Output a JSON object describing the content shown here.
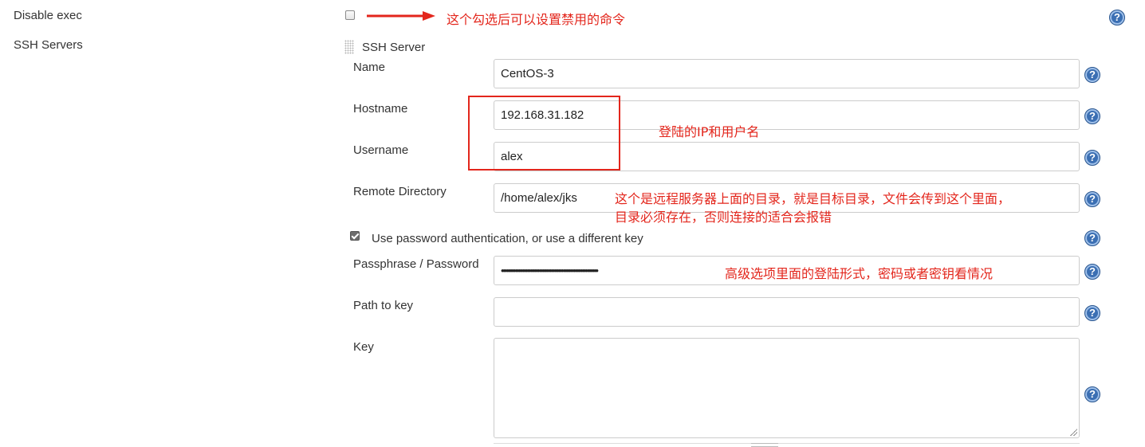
{
  "labels": {
    "disable_exec": "Disable exec",
    "ssh_servers": "SSH Servers",
    "ssh_server": "SSH Server",
    "name": "Name",
    "hostname": "Hostname",
    "username": "Username",
    "remote_directory": "Remote Directory",
    "use_password": "Use password authentication, or use a different key",
    "passphrase": "Passphrase / Password",
    "path_to_key": "Path to key",
    "key": "Key"
  },
  "values": {
    "name": "CentOS-3",
    "hostname": "192.168.31.182",
    "username": "alex",
    "remote_directory": "/home/alex/jks",
    "passphrase_masked": "••••••••••••••••••••••••••••••••••••••••••••••••••••••••",
    "path_to_key": "",
    "key": ""
  },
  "checkboxes": {
    "disable_exec_checked": false,
    "use_password_checked": true
  },
  "annotations": {
    "disable_exec_note": "这个勾选后可以设置禁用的命令",
    "login_note": "登陆的IP和用户名",
    "remote_dir_note_line1": "这个是远程服务器上面的目录，就是目标目录，文件会传到这个里面，",
    "remote_dir_note_line2": "目录必须存在，否则连接的适合会报错",
    "advanced_note": "高级选项里面的登陆形式，密码或者密钥看情况"
  },
  "help_glyph": "?",
  "colors": {
    "annotation_red": "#e3261c",
    "help_blue": "#3b6fb3"
  }
}
